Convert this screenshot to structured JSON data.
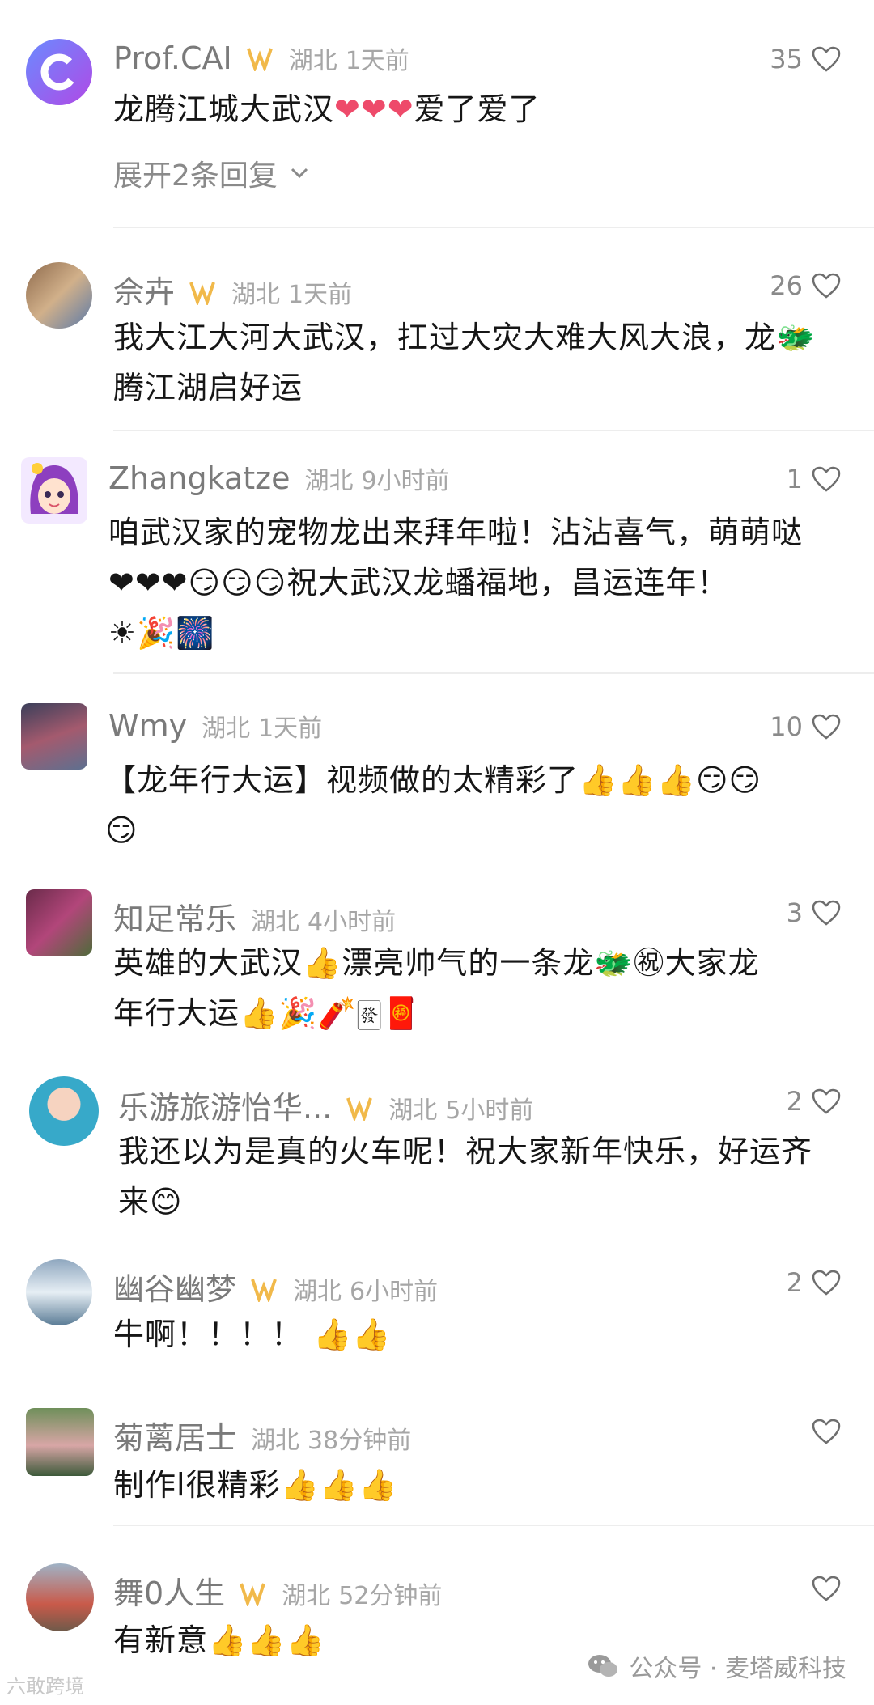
{
  "comments": [
    {
      "user": "Prof.CAI",
      "loc": "湖北",
      "time": "1天前",
      "likes": "35",
      "parts": [
        "龙腾江城大武汉",
        "❤❤❤",
        "爱了爱了"
      ],
      "expand": "展开2条回复"
    },
    {
      "user": "佘卉",
      "loc": "湖北",
      "time": "1天前",
      "likes": "26",
      "parts": [
        "我大江大河大武汉，扛过大灾大难大风大浪，龙🐲",
        "腾江湖启好运"
      ]
    },
    {
      "user": "Zhangkatze",
      "loc": "湖北",
      "time": "9小时前",
      "likes": "1",
      "parts": [
        "咱武汉家的宠物龙出来拜年啦！沾沾喜气，萌萌哒",
        "❤❤❤😏😏😏祝大武汉龙蟠福地，昌运连年！",
        "☀🎉🎆"
      ]
    },
    {
      "user": "Wmy",
      "loc": "湖北",
      "time": "1天前",
      "likes": "10",
      "parts": [
        "【龙年行大运】视频做的太精彩了👍👍👍😏😏",
        "😏"
      ]
    },
    {
      "user": "知足常乐",
      "loc": "湖北",
      "time": "4小时前",
      "likes": "3",
      "parts": [
        "英雄的大武汉👍漂亮帅气的一条龙🐲㊗大家龙",
        "年行大运👍🎉🧨🀅🧧"
      ]
    },
    {
      "user": "乐游旅游怡华...",
      "loc": "湖北",
      "time": "5小时前",
      "likes": "2",
      "parts": [
        "我还以为是真的火车呢！祝大家新年快乐，好运齐",
        "来😊"
      ]
    },
    {
      "user": "幽谷幽梦",
      "loc": "湖北",
      "time": "6小时前",
      "likes": "2",
      "parts": [
        "牛啊！！！！ 👍👍"
      ]
    },
    {
      "user": "菊蓠居士",
      "loc": "湖北",
      "time": "38分钟前",
      "likes": "",
      "parts": [
        "制作l很精彩👍👍👍"
      ]
    },
    {
      "user": "舞0人生",
      "loc": "湖北",
      "time": "52分钟前",
      "likes": "",
      "parts": [
        "有新意👍👍👍"
      ]
    }
  ],
  "watermark": {
    "left": "六敢跨境",
    "right": "公众号 · 麦塔威科技"
  },
  "colors": {
    "heart": "#ee4a6a",
    "thumb": "#f6c343",
    "badge": "#f1b94a",
    "text": "#161616",
    "meta": "#8a8a8a"
  }
}
